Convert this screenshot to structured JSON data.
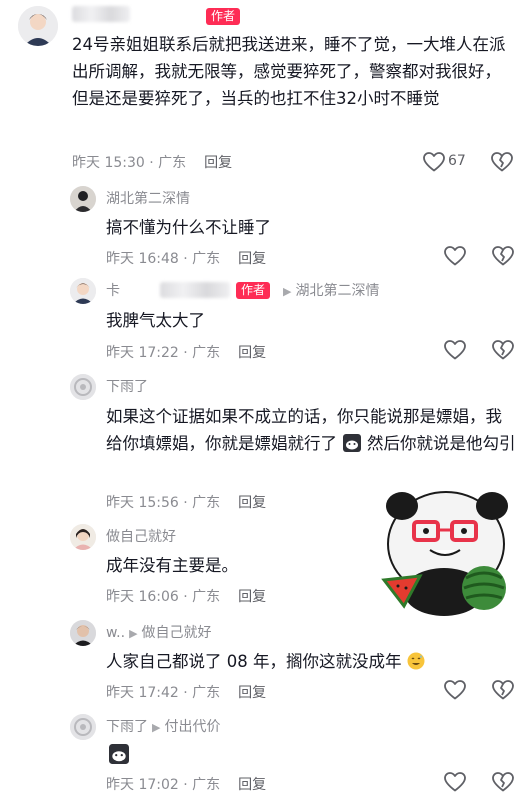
{
  "main_comment": {
    "author_tag": "作者",
    "text": "24号亲姐姐联系后就把我送进来，睡不了觉，一大堆人在派出所调解，我就无限等，感觉要猝死了，警察都对我很好，但是还是要猝死了，当兵的也扛不住32小时不睡觉",
    "time": "昨天 15:30 · 广东",
    "reply_label": "回复",
    "likes": "67"
  },
  "replies": [
    {
      "name": "湖北第二深情",
      "text": "搞不懂为什么不让睡了",
      "time": "昨天 16:48 · 广东",
      "reply_label": "回复"
    },
    {
      "name": "卡",
      "author_tag": "作者",
      "reply_to": "湖北第二深情",
      "text": "我脾气太大了",
      "time": "昨天 17:22 · 广东",
      "reply_label": "回复"
    },
    {
      "name": "下雨了",
      "text_a": "如果这个证据如果不成立的话，你只能说那是嫖娼，我给你填嫖娼，你就是嫖娼就行了",
      "text_b": "然后你就说是他勾引",
      "time": "昨天 15:56 · 广东",
      "reply_label": "回复"
    },
    {
      "name": "做自己就好",
      "text": "成年没有主要是。",
      "time": "昨天 16:06 · 广东",
      "reply_label": "回复"
    },
    {
      "name": "w..",
      "reply_to": "做自己就好",
      "text": "人家自己都说了 08 年，搁你这就没成年",
      "time": "昨天 17:42 · 广东",
      "reply_label": "回复"
    },
    {
      "name": "下雨了",
      "reply_to": "付出代价",
      "time": "昨天 17:02 · 广东",
      "reply_label": "回复"
    }
  ],
  "icons": {
    "like": "heart-outline-icon",
    "dislike": "broken-heart-icon",
    "arrow": "play-arrow-icon"
  },
  "colors": {
    "author_tag": "#fe2c55",
    "meta_text": "#8a8b91",
    "body_text": "#161823"
  }
}
